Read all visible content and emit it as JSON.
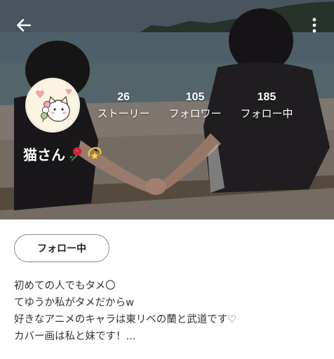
{
  "header": {
    "back_icon": "arrow-left-icon",
    "more_icon": "more-vertical-icon"
  },
  "cover": {
    "description_icon": "cover-photo"
  },
  "profile": {
    "avatar_icon": "cat-avatar",
    "name": "猫さん",
    "name_emojis": [
      "rose-emoji",
      "dizzy-star-emoji"
    ]
  },
  "stats": [
    {
      "count": "26",
      "label": "ストーリー"
    },
    {
      "count": "105",
      "label": "フォロワー"
    },
    {
      "count": "185",
      "label": "フォロー中"
    }
  ],
  "actions": {
    "follow_label": "フォロー中"
  },
  "bio": {
    "lines": [
      "初めての人でもタメ〇",
      "てゆうか私がタメだからw",
      "好きなアニメのキャラは東リベの蘭と武道です♡",
      "カバー画は私と妹です！..."
    ]
  },
  "colors": {
    "text_primary": "#333333",
    "button_border": "#8a8a8a",
    "overlay_text": "#ffffff"
  }
}
